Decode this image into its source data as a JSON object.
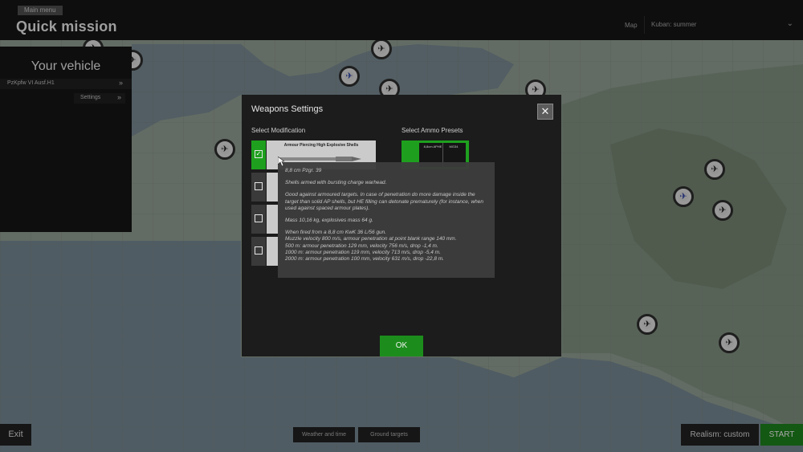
{
  "header": {
    "breadcrumb": "Main menu",
    "title": "Quick mission",
    "map_label": "Map",
    "map_value": "Kuban: summer"
  },
  "vehicle": {
    "title": "Your vehicle",
    "name": "PzKpfw VI Ausf.H1",
    "settings_label": "Settings"
  },
  "bottom": {
    "exit": "Exit",
    "weather_tab": "Weather and time",
    "ground_tab": "Ground targets",
    "realism": "Realism: custom",
    "start": "START"
  },
  "modal": {
    "title": "Weapons Settings",
    "close_glyph": "✕",
    "modification_heading": "Select Modification",
    "ammo_heading": "Select Ammo Presets",
    "modifications": [
      {
        "title": "Armour Piercing High Explosive Shells",
        "checked": true,
        "check_glyph": "✓"
      },
      {
        "title": "",
        "checked": false
      },
      {
        "title": "",
        "checked": false
      },
      {
        "title": "",
        "checked": false
      }
    ],
    "ammo_preset": {
      "left": "8,8cm APHE",
      "right": "MG34"
    },
    "ok": "OK"
  },
  "tooltip": {
    "name": "8,8 cm Pzgr. 39",
    "description": "Shells armed with bursting charge warhead.",
    "notes": "Good against armoured targets. In case of penetration do more damage inside the target than solid AP shells, but HE filling can detonate prematurely (for instance, when used against spaced armour plates).",
    "mass": "Mass 10,16 kg, explosives mass 64 g.",
    "gun": "When fired from a 8,8 cm KwK 36 L/56 gun.",
    "muzzle": "Muzzle velocity 800 m/s, armour penetration at point blank range 140 mm.",
    "r500": "500 m: armour penetration 129 mm, velocity 756 m/s, drop -1,4 m.",
    "r1000": "1000 m: armour penetration 119 mm, velocity 713 m/s, drop -5,4 m.",
    "r2000": "2000 m: armour penetration 100 mm, velocity 631 m/s, drop -22,8 m."
  },
  "colors": {
    "accent_green": "#1ea01e",
    "panel_dark": "#1c1c1c"
  },
  "icons": {
    "close": "close-icon",
    "chevron": "chevron-double-right-icon",
    "dropdown": "chevron-down-icon",
    "marker": "aircraft-target-marker-icon"
  }
}
